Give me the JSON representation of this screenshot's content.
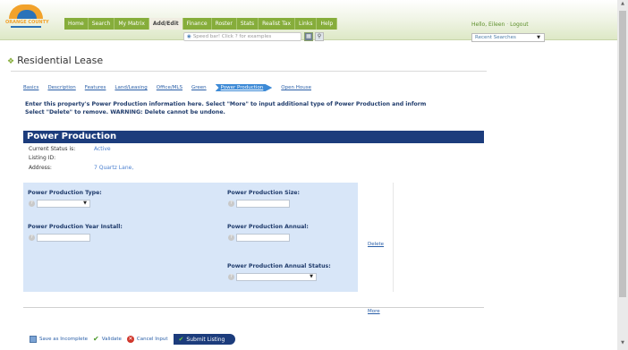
{
  "header": {
    "logo": "ORANGE COUNTY",
    "nav": [
      {
        "label": "Home",
        "active": false
      },
      {
        "label": "Search",
        "active": false
      },
      {
        "label": "My Matrix",
        "active": false
      },
      {
        "label": "Add/Edit",
        "active": true
      },
      {
        "label": "Finance",
        "active": false
      },
      {
        "label": "Roster",
        "active": false
      },
      {
        "label": "Stats",
        "active": false
      },
      {
        "label": "Realist Tax",
        "active": false
      },
      {
        "label": "Links",
        "active": false
      },
      {
        "label": "Help",
        "active": false
      }
    ],
    "search_placeholder": "Speed bar! Click ? for examples",
    "greeting": "Hello, Eileen",
    "logout": "Logout",
    "recent_searches": "Recent Searches"
  },
  "page": {
    "title": "Residential Lease",
    "steps": [
      "Basics",
      "Description",
      "Features",
      "Land/Leasing",
      "Office/MLS",
      "Green",
      "Power Production",
      "Open House"
    ],
    "current_step": "Power Production",
    "instructions_line1": "Enter this property's Power Production information here. Select \"More\" to input additional type of Power Production and inform",
    "instructions_line2": "Select \"Delete\" to remove.  WARNING: Delete cannot be undone."
  },
  "section": {
    "title": "Power Production",
    "current_status_label": "Current Status is:",
    "current_status_value": "Active",
    "listing_id_label": "Listing ID:",
    "listing_id_value": "",
    "address_label": "Address:",
    "address_value": "7 Quartz Lane,"
  },
  "form": {
    "type_label": "Power Production Type:",
    "size_label": "Power Production Size:",
    "year_label": "Power Production Year Install:",
    "annual_label": "Power Production Annual:",
    "annual_status_label": "Power Production Annual Status:",
    "delete_link": "Delete",
    "more_link": "More"
  },
  "footer": {
    "save_incomplete": "Save as Incomplete",
    "validate": "Validate",
    "cancel_input": "Cancel Input",
    "submit": "Submit Listing"
  }
}
